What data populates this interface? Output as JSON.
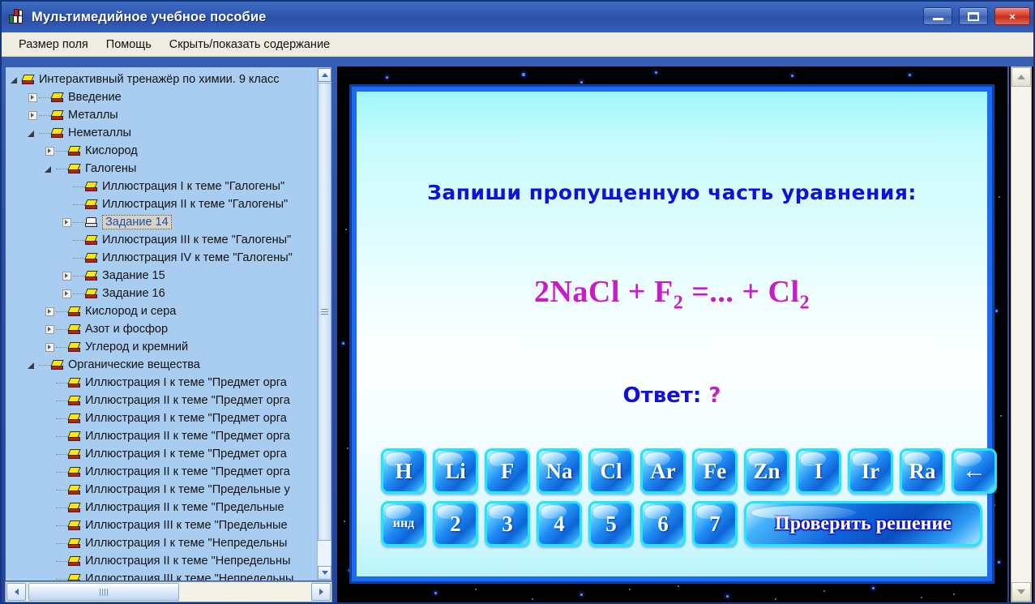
{
  "window": {
    "title": "Мультимедийное учебное пособие",
    "icon": "books-icon",
    "controls": {
      "minimize": "minimize-icon",
      "restore": "restore-icon",
      "close": "×"
    }
  },
  "menu": {
    "items": [
      {
        "label": "Размер поля"
      },
      {
        "label": "Помощь"
      },
      {
        "label": "Скрыть/показать содержание"
      }
    ]
  },
  "tree": {
    "items": [
      {
        "label": "Интерактивный тренажёр по химии. 9 класс",
        "depth": 0,
        "state": "expanded",
        "icon": "book-icon",
        "selected": false
      },
      {
        "label": "Введение",
        "depth": 1,
        "state": "collapsed",
        "icon": "book-icon",
        "selected": false
      },
      {
        "label": "Металлы",
        "depth": 1,
        "state": "collapsed",
        "icon": "book-icon",
        "selected": false
      },
      {
        "label": "Неметаллы",
        "depth": 1,
        "state": "expanded",
        "icon": "book-icon",
        "selected": false
      },
      {
        "label": "Кислород",
        "depth": 2,
        "state": "collapsed",
        "icon": "book-icon",
        "selected": false
      },
      {
        "label": "Галогены",
        "depth": 2,
        "state": "expanded",
        "icon": "book-icon",
        "selected": false
      },
      {
        "label": "Иллюстрация I к теме \"Галогены\"",
        "depth": 3,
        "state": "leaf",
        "icon": "book-icon",
        "selected": false
      },
      {
        "label": "Иллюстрация II к теме \"Галогены\"",
        "depth": 3,
        "state": "leaf",
        "icon": "book-icon",
        "selected": false
      },
      {
        "label": "Задание 14",
        "depth": 3,
        "state": "collapsed",
        "icon": "open-book-icon",
        "selected": true
      },
      {
        "label": "Иллюстрация III к теме \"Галогены\"",
        "depth": 3,
        "state": "leaf",
        "icon": "book-icon",
        "selected": false
      },
      {
        "label": "Иллюстрация IV к теме \"Галогены\"",
        "depth": 3,
        "state": "leaf",
        "icon": "book-icon",
        "selected": false
      },
      {
        "label": "Задание 15",
        "depth": 3,
        "state": "collapsed",
        "icon": "book-icon",
        "selected": false
      },
      {
        "label": "Задание 16",
        "depth": 3,
        "state": "collapsed",
        "icon": "book-icon",
        "selected": false
      },
      {
        "label": "Кислород и сера",
        "depth": 2,
        "state": "collapsed",
        "icon": "book-icon",
        "selected": false
      },
      {
        "label": "Азот и фосфор",
        "depth": 2,
        "state": "collapsed",
        "icon": "book-icon",
        "selected": false
      },
      {
        "label": "Углерод и кремний",
        "depth": 2,
        "state": "collapsed",
        "icon": "book-icon",
        "selected": false
      },
      {
        "label": "Органические вещества",
        "depth": 1,
        "state": "expanded",
        "icon": "book-icon",
        "selected": false
      },
      {
        "label": "Иллюстрация I к теме \"Предмет орга",
        "depth": 2,
        "state": "leaf",
        "icon": "book-icon",
        "selected": false
      },
      {
        "label": "Иллюстрация II к теме \"Предмет орга",
        "depth": 2,
        "state": "leaf",
        "icon": "book-icon",
        "selected": false
      },
      {
        "label": "Иллюстрация I к теме \"Предмет орга",
        "depth": 2,
        "state": "leaf",
        "icon": "book-icon",
        "selected": false
      },
      {
        "label": "Иллюстрация II к теме \"Предмет орга",
        "depth": 2,
        "state": "leaf",
        "icon": "book-icon",
        "selected": false
      },
      {
        "label": "Иллюстрация I к теме \"Предмет орга",
        "depth": 2,
        "state": "leaf",
        "icon": "book-icon",
        "selected": false
      },
      {
        "label": "Иллюстрация II к теме \"Предмет орга",
        "depth": 2,
        "state": "leaf",
        "icon": "book-icon",
        "selected": false
      },
      {
        "label": "Иллюстрация I к теме \"Предельные у",
        "depth": 2,
        "state": "leaf",
        "icon": "book-icon",
        "selected": false
      },
      {
        "label": "Иллюстрация II к теме \"Предельные ",
        "depth": 2,
        "state": "leaf",
        "icon": "book-icon",
        "selected": false
      },
      {
        "label": "Иллюстрация III к теме \"Предельные",
        "depth": 2,
        "state": "leaf",
        "icon": "book-icon",
        "selected": false
      },
      {
        "label": "Иллюстрация I к теме \"Непредельны",
        "depth": 2,
        "state": "leaf",
        "icon": "book-icon",
        "selected": false
      },
      {
        "label": "Иллюстрация II к теме \"Непредельны",
        "depth": 2,
        "state": "leaf",
        "icon": "book-icon",
        "selected": false
      },
      {
        "label": "Иллюстрация III к теме \"Непредельны",
        "depth": 2,
        "state": "leaf",
        "icon": "book-icon",
        "selected": false
      }
    ]
  },
  "slide": {
    "prompt": "Запиши пропущенную часть уравнения:",
    "equation": {
      "lead": "2NaCl + F",
      "sub1": "2",
      "mid": " =... + Cl",
      "sub2": "2"
    },
    "answer": {
      "label": "Ответ:",
      "value": "?"
    },
    "keypad": {
      "row1": [
        {
          "label": "H",
          "name": "key-h"
        },
        {
          "label": "Li",
          "name": "key-li"
        },
        {
          "label": "F",
          "name": "key-f"
        },
        {
          "label": "Na",
          "name": "key-na"
        },
        {
          "label": "Cl",
          "name": "key-cl"
        },
        {
          "label": "Ar",
          "name": "key-ar"
        },
        {
          "label": "Fe",
          "name": "key-fe"
        },
        {
          "label": "Zn",
          "name": "key-zn"
        },
        {
          "label": "I",
          "name": "key-i"
        },
        {
          "label": "Ir",
          "name": "key-ir"
        },
        {
          "label": "Ra",
          "name": "key-ra"
        },
        {
          "label": "←",
          "name": "key-backspace"
        }
      ],
      "row2": [
        {
          "label": "инд",
          "name": "key-index"
        },
        {
          "label": "2",
          "name": "key-2"
        },
        {
          "label": "3",
          "name": "key-3"
        },
        {
          "label": "4",
          "name": "key-4"
        },
        {
          "label": "5",
          "name": "key-5"
        },
        {
          "label": "6",
          "name": "key-6"
        },
        {
          "label": "7",
          "name": "key-7"
        }
      ],
      "check_button": "Проверить решение"
    }
  },
  "colors": {
    "title_bar": "#2d54ab",
    "menu_bar": "#efece1",
    "tree_bg": "#a8cdf0",
    "prompt_blue": "#1010d8",
    "equation_magenta": "#c81cc8",
    "key_blue": "#1e8cf5",
    "key_border_cyan": "#22e6ff",
    "close_red": "#c42e1c"
  }
}
